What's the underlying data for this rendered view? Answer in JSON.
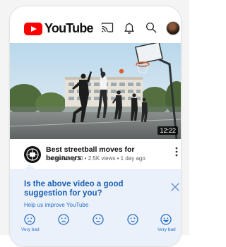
{
  "header": {
    "logo_text": "YouTube",
    "icons": [
      "cast-icon",
      "bell-icon",
      "search-icon",
      "avatar"
    ]
  },
  "video": {
    "duration": "12:22",
    "title": "Best streetball moves for beginners",
    "subtitle": "Hoop Swag 30 • 2.5K views • 1 day ago"
  },
  "survey": {
    "question": "Is the above video a good suggestion for you?",
    "help_link": "Help us improve YouTube",
    "scale_low": "Very bad",
    "scale_high": "Very bad"
  },
  "colors": {
    "brand": "#ff0000",
    "accent_blue": "#1a5fb4",
    "survey_bg": "#eaf1fb"
  }
}
